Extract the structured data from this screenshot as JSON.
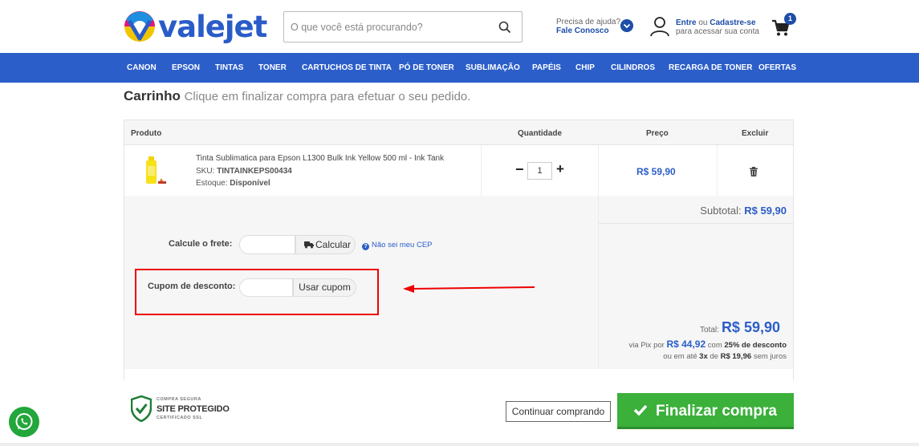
{
  "brand": {
    "name": "valejet",
    "accent": "#2b5ec9"
  },
  "search": {
    "placeholder": "O que você está procurando?",
    "icon": "search-icon"
  },
  "help": {
    "question": "Precisa de ajuda?",
    "link": "Fale Conosco"
  },
  "account": {
    "login": "Entre",
    "or": "ou",
    "signup": "Cadastre-se",
    "sub": "para acessar sua conta"
  },
  "cart": {
    "badge": "1"
  },
  "nav": {
    "items": [
      {
        "label": "CANON"
      },
      {
        "label": "EPSON"
      },
      {
        "label": "TINTAS"
      },
      {
        "label": "TONER"
      },
      {
        "label": "CARTUCHOS DE TINTA"
      },
      {
        "label": "PÓ DE TONER"
      },
      {
        "label": "SUBLIMAÇÃO"
      },
      {
        "label": "PAPÉIS"
      },
      {
        "label": "CHIP"
      },
      {
        "label": "CILINDROS"
      },
      {
        "label": "RECARGA DE TONER"
      },
      {
        "label": "OFERTAS"
      }
    ]
  },
  "page": {
    "title": "Carrinho",
    "subtitle": "Clique em finalizar compra para efetuar o seu pedido."
  },
  "table": {
    "headers": {
      "product": "Produto",
      "quantity": "Quantidade",
      "price": "Preço",
      "remove": "Excluir"
    },
    "item": {
      "name": "Tinta Sublimatica para Epson L1300 Bulk Ink Yellow 500 ml - Ink Tank",
      "sku_label": "SKU:",
      "sku": "TINTAINKEPS00434",
      "stock_label": "Estoque:",
      "stock": "Disponível",
      "quantity": "1",
      "price": "R$ 59,90"
    }
  },
  "summary": {
    "subtotal_label": "Subtotal:",
    "subtotal": "R$ 59,90",
    "total_label": "Total:",
    "total": "R$ 59,90",
    "pix_prefix": "via Pix por",
    "pix_value": "R$ 44,92",
    "pix_mid": "com",
    "pix_discount": "25% de desconto",
    "parc_prefix": "ou em até",
    "parc_n": "3x",
    "parc_de": "de",
    "parc_value": "R$ 19,96",
    "parc_suffix": "sem juros"
  },
  "shipping": {
    "label": "Calcule o frete:",
    "button": "Calcular",
    "help": "Não sei meu CEP"
  },
  "coupon": {
    "label": "Cupom de desconto:",
    "button": "Usar cupom"
  },
  "seal": {
    "top": "COMPRA SEGURA",
    "main": "SITE PROTEGIDO",
    "bottom": "CERTIFICADO SSL"
  },
  "actions": {
    "continue": "Continuar comprando",
    "finalize": "Finalizar compra"
  }
}
